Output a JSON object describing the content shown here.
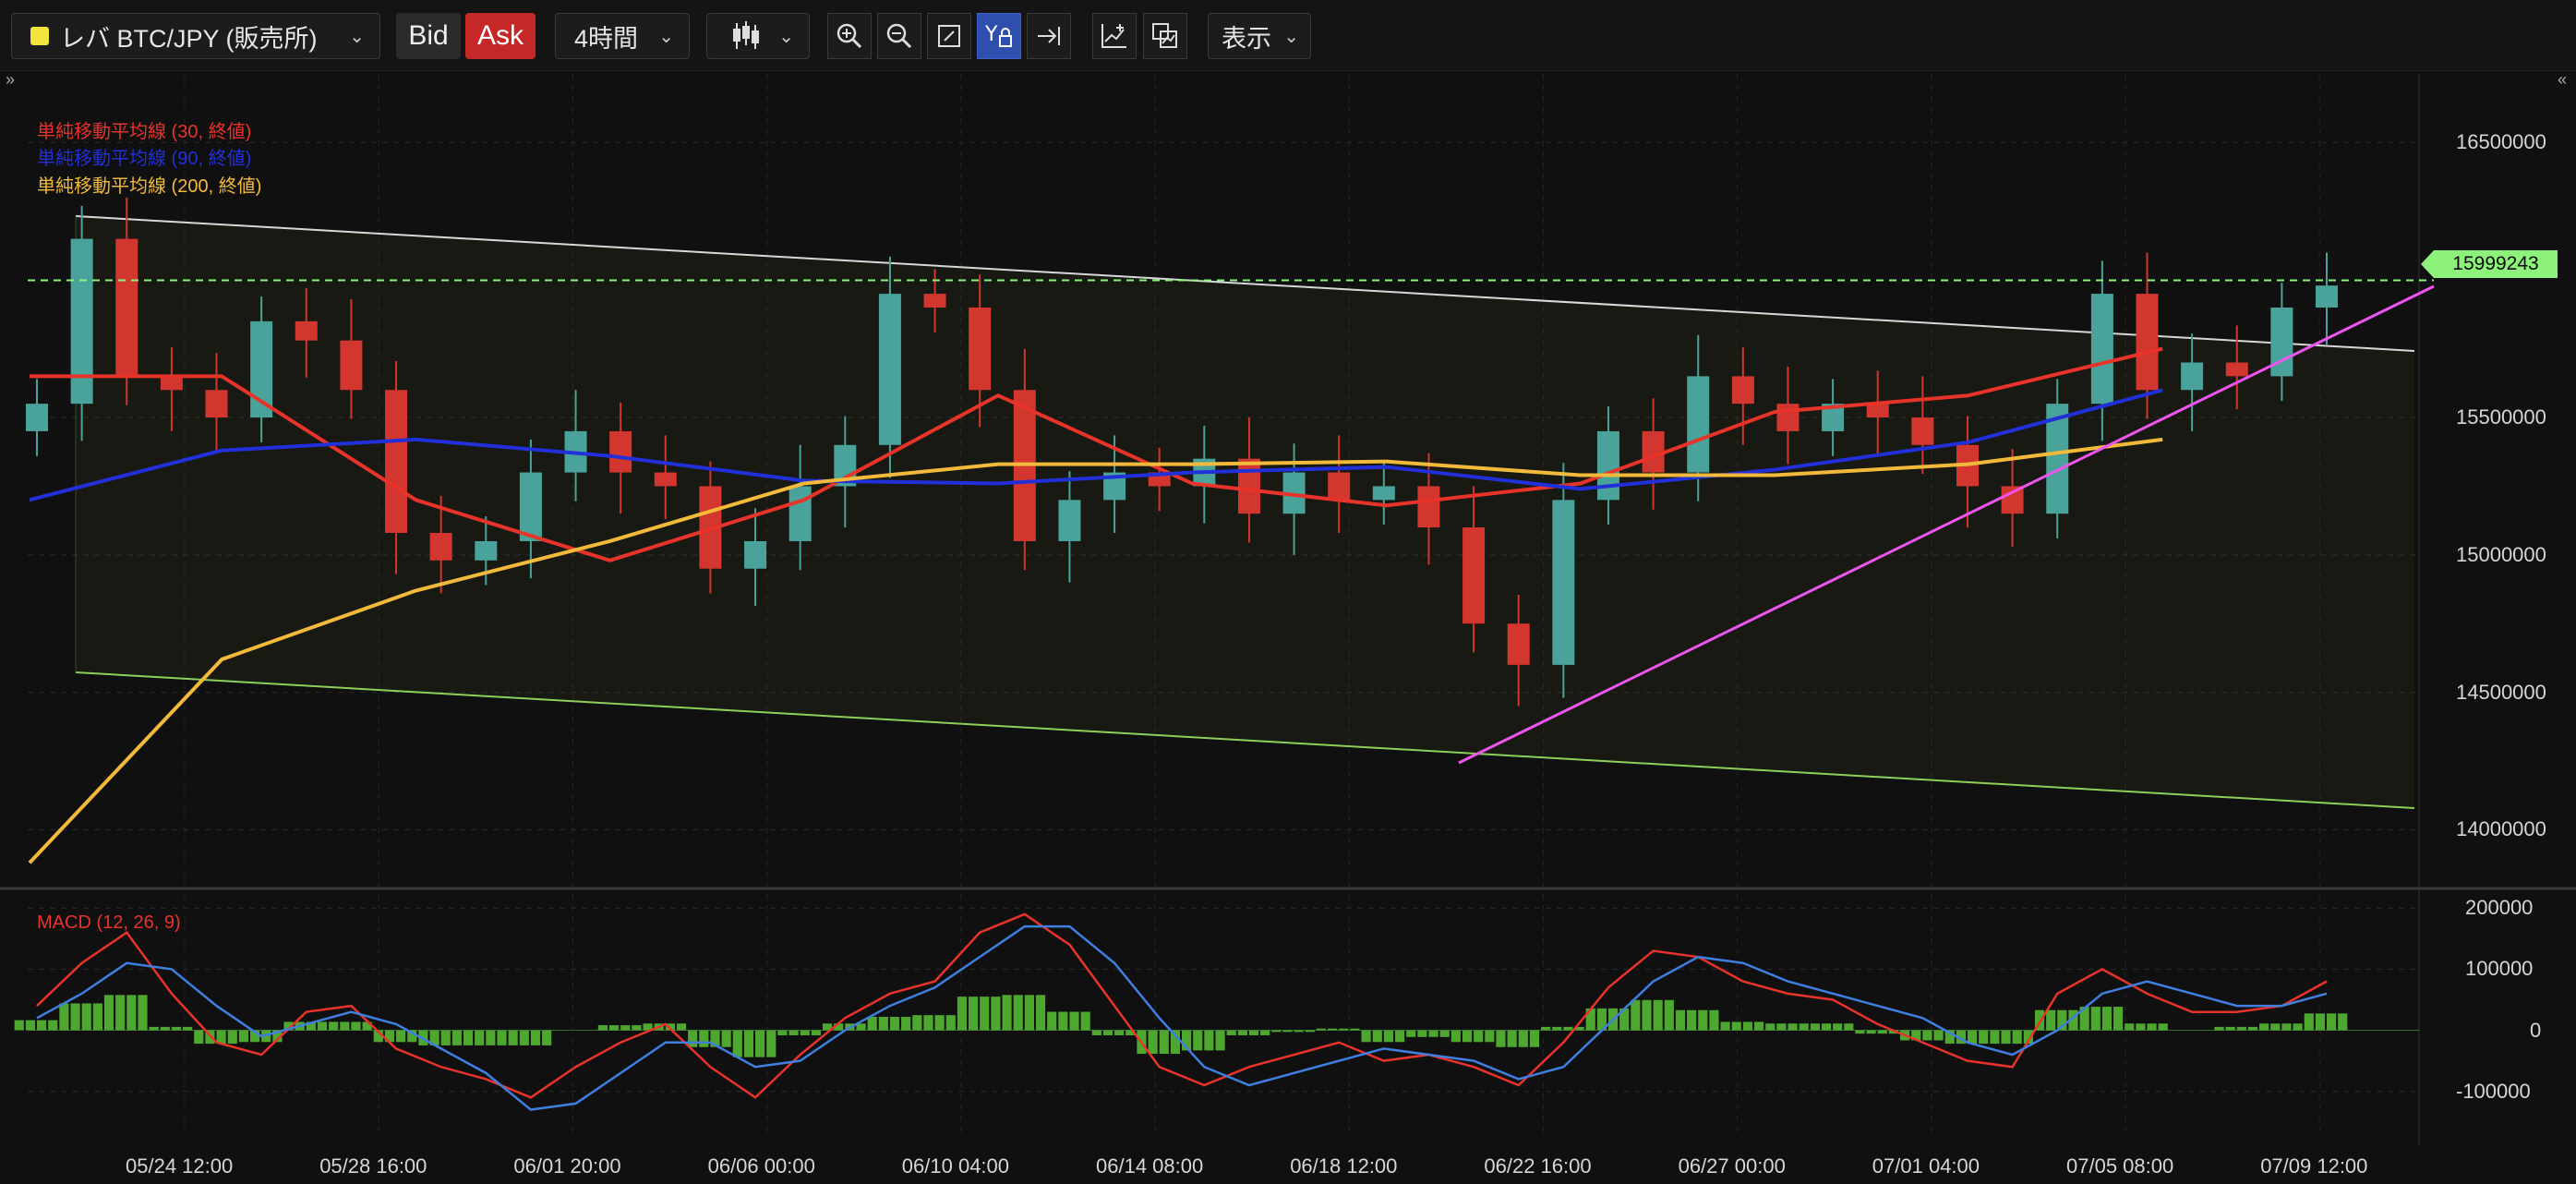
{
  "toolbar": {
    "symbol": "レバ BTC/JPY (販売所)",
    "bid": "Bid",
    "ask": "Ask",
    "timeframe": "4時間",
    "display": "表示",
    "colors": {
      "bid_bg": "#2a2a2a",
      "ask_bg": "#c62828",
      "active_tool": "#2f4fae"
    },
    "icons": [
      "candlestick-icon",
      "zoom-in-icon",
      "zoom-out-icon",
      "fit-screen-icon",
      "auto-scale-icon",
      "scroll-to-end-icon",
      "add-indicator-icon",
      "compare-icon"
    ]
  },
  "legend": {
    "sma30": "単純移動平均線 (30, 終値)",
    "sma90": "単純移動平均線 (90, 終値)",
    "sma200": "単純移動平均線 (200, 終値)",
    "macd": "MACD (12, 26, 9)"
  },
  "colors": {
    "sma30": "#e8332a",
    "sma90": "#2130d8",
    "sma200": "#f2b93b",
    "up_candle": "#4aa39a",
    "down_candle": "#d2362e",
    "macd_line": "#e8332a",
    "signal_line": "#3f7fe0",
    "histogram": "#4ea830",
    "channel_top": "#d8d8d8",
    "channel_bottom": "#8ccf5a",
    "trendline": "#ee55ee",
    "current_price": "#8df27a"
  },
  "current_price": "15999243",
  "chart_data": [
    {
      "type": "candlestick",
      "title": "",
      "y_axis_ticks": [
        "16500000",
        "15500000",
        "15000000",
        "14500000",
        "14000000"
      ],
      "ylim": [
        13800000,
        16750000
      ],
      "x_axis_ticks": [
        "05/24 12:00",
        "05/28 16:00",
        "06/01 20:00",
        "06/06 00:00",
        "06/10 04:00",
        "06/14 08:00",
        "06/18 12:00",
        "06/22 16:00",
        "06/27 00:00",
        "07/01 04:00",
        "07/05 08:00",
        "07/09 12:00"
      ],
      "series": [
        {
          "name": "単純移動平均線 (30, 終値)",
          "x": [
            "05/24 12:00",
            "05/28 16:00",
            "06/01 20:00",
            "06/06 00:00",
            "06/10 04:00",
            "06/14 08:00",
            "06/18 12:00",
            "06/22 16:00",
            "06/27 00:00",
            "07/01 04:00",
            "07/05 08:00",
            "07/09 12:00"
          ],
          "values": [
            15700000,
            15650000,
            15200000,
            14980000,
            15200000,
            15580000,
            15260000,
            15180000,
            15260000,
            15520000,
            15580000,
            15750000
          ]
        },
        {
          "name": "単純移動平均線 (90, 終値)",
          "x": [
            "05/24 12:00",
            "05/28 16:00",
            "06/01 20:00",
            "06/06 00:00",
            "06/10 04:00",
            "06/14 08:00",
            "06/18 12:00",
            "06/22 16:00",
            "06/27 00:00",
            "07/01 04:00",
            "07/05 08:00",
            "07/09 12:00"
          ],
          "values": [
            15250000,
            15380000,
            15420000,
            15360000,
            15270000,
            15260000,
            15300000,
            15320000,
            15240000,
            15310000,
            15410000,
            15600000
          ]
        },
        {
          "name": "単純移動平均線 (200, 終値)",
          "x": [
            "05/24 12:00",
            "05/28 16:00",
            "06/01 20:00",
            "06/06 00:00",
            "06/10 04:00",
            "06/14 08:00",
            "06/18 12:00",
            "06/22 16:00",
            "06/27 00:00",
            "07/01 04:00",
            "07/05 08:00",
            "07/09 12:00"
          ],
          "values": [
            14260000,
            14620000,
            14870000,
            15050000,
            15260000,
            15330000,
            15330000,
            15340000,
            15290000,
            15290000,
            15330000,
            15420000
          ]
        }
      ],
      "candle_closes": [
        15550000,
        16150000,
        15650000,
        15600000,
        15500000,
        15850000,
        15780000,
        15600000,
        15080000,
        14980000,
        15050000,
        15300000,
        15450000,
        15300000,
        15250000,
        14950000,
        15050000,
        15250000,
        15400000,
        15950000,
        15900000,
        15600000,
        15050000,
        15200000,
        15300000,
        15250000,
        15350000,
        15150000,
        15300000,
        15200000,
        15250000,
        15100000,
        14750000,
        14600000,
        15200000,
        15450000,
        15300000,
        15650000,
        15550000,
        15450000,
        15550000,
        15500000,
        15400000,
        15250000,
        15150000,
        15550000,
        15950000,
        15600000,
        15700000,
        15650000,
        15900000,
        15980000
      ]
    },
    {
      "type": "bar",
      "title": "",
      "y_axis_ticks": [
        "200000",
        "100000",
        "0",
        "-100000"
      ],
      "ylim": [
        -170000,
        220000
      ],
      "series": [
        {
          "name": "MACD",
          "values": [
            40000,
            110000,
            160000,
            60000,
            -20000,
            -40000,
            30000,
            40000,
            -30000,
            -60000,
            -80000,
            -110000,
            -60000,
            -20000,
            10000,
            -60000,
            -110000,
            -40000,
            20000,
            60000,
            80000,
            160000,
            190000,
            140000,
            40000,
            -60000,
            -90000,
            -60000,
            -40000,
            -20000,
            -50000,
            -40000,
            -60000,
            -90000,
            -20000,
            70000,
            130000,
            120000,
            80000,
            60000,
            50000,
            10000,
            -20000,
            -50000,
            -60000,
            60000,
            100000,
            60000,
            30000,
            30000,
            40000,
            80000
          ]
        },
        {
          "name": "Signal",
          "values": [
            20000,
            60000,
            110000,
            100000,
            40000,
            -10000,
            10000,
            30000,
            10000,
            -30000,
            -70000,
            -130000,
            -120000,
            -70000,
            -20000,
            -20000,
            -60000,
            -50000,
            0,
            40000,
            70000,
            120000,
            170000,
            170000,
            110000,
            20000,
            -60000,
            -90000,
            -70000,
            -50000,
            -30000,
            -40000,
            -50000,
            -80000,
            -60000,
            10000,
            80000,
            120000,
            110000,
            80000,
            60000,
            40000,
            20000,
            -20000,
            -40000,
            0,
            60000,
            80000,
            60000,
            40000,
            40000,
            60000
          ]
        }
      ]
    }
  ]
}
